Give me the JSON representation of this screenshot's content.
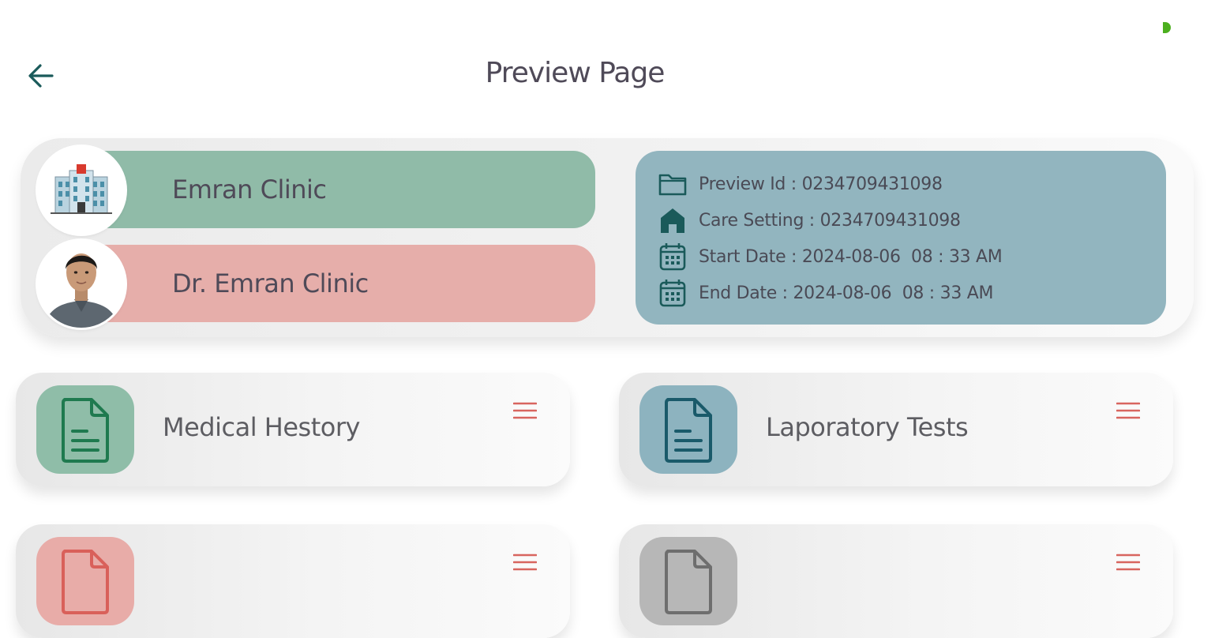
{
  "app": {
    "title": "Preview Page"
  },
  "header": {
    "clinic_name": "Emran Clinic",
    "doctor_name": "Dr. Emran Clinic"
  },
  "info": {
    "preview_id": "Preview Id : 0234709431098",
    "care_setting": "Care Setting : 0234709431098",
    "start_date": "Start Date : 2024-08-06  08 : 33 AM",
    "end_date": "End Date : 2024-08-06  08 : 33 AM"
  },
  "sections": [
    {
      "label": "Medical Hestory",
      "icon": "document-icon",
      "color": "#8fbda8",
      "icon_color": "#1f7a4f"
    },
    {
      "label": "Laporatory Tests",
      "icon": "document-icon",
      "color": "#8db3bf",
      "icon_color": "#1a5a6a"
    },
    {
      "label": "",
      "icon": "document-icon",
      "color": "#e8aca8",
      "icon_color": "#d9605a"
    },
    {
      "label": "",
      "icon": "document-icon",
      "color": "#b7b7b7",
      "icon_color": "#6e6e6e"
    }
  ],
  "colors": {
    "accent_teal": "#1a5a5a",
    "menu_red": "#d8655f",
    "status_green": "#4caf1f"
  },
  "icons": [
    "back-arrow-icon",
    "folder-icon",
    "home-icon",
    "calendar-icon",
    "menu-icon",
    "hospital-icon"
  ]
}
